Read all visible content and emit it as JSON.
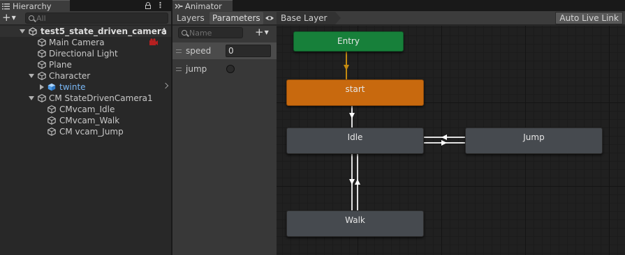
{
  "hierarchy": {
    "title": "Hierarchy",
    "search_placeholder": "All",
    "scene_name": "test5_state_driven_camera",
    "items": [
      {
        "label": "Main Camera"
      },
      {
        "label": "Directional Light"
      },
      {
        "label": "Plane"
      },
      {
        "label": "Character"
      },
      {
        "label": "twinte"
      },
      {
        "label": "CM StateDrivenCamera1"
      },
      {
        "label": "CMvcam_Idle"
      },
      {
        "label": "CMvcam_Walk"
      },
      {
        "label": "CM vcam_Jump"
      }
    ]
  },
  "animator": {
    "title": "Animator",
    "tabs": [
      "Layers",
      "Parameters"
    ],
    "active_tab": "Parameters",
    "breadcrumb": "Base Layer",
    "live_link": "Auto Live Link",
    "param_search_placeholder": "Name",
    "parameters": [
      {
        "name": "speed",
        "type": "float",
        "value": "0"
      },
      {
        "name": "jump",
        "type": "bool",
        "value": false
      }
    ],
    "states": {
      "entry": "Entry",
      "start": "start",
      "idle": "Idle",
      "jump": "Jump",
      "walk": "Walk"
    }
  },
  "colors": {
    "entry": "#17803a",
    "default_state": "#c8690e",
    "state": "#464a4f",
    "prefab_blue": "#7ab8f5"
  }
}
